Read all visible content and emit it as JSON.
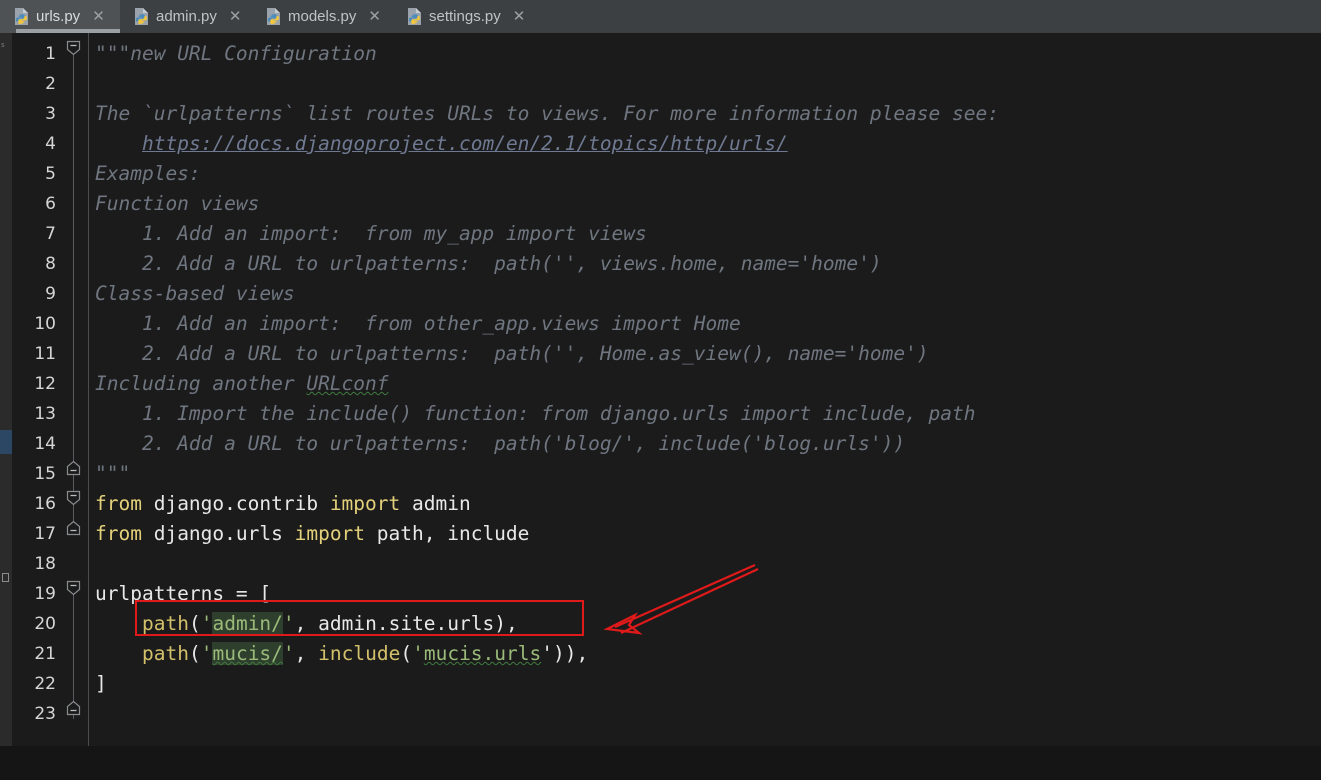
{
  "window": {
    "title": "urls.py"
  },
  "tabs": [
    {
      "label": "urls.py",
      "icon": "python-file-icon",
      "close": "✕",
      "active": true
    },
    {
      "label": "admin.py",
      "icon": "python-file-icon",
      "close": "✕",
      "active": false
    },
    {
      "label": "models.py",
      "icon": "python-file-icon",
      "close": "✕",
      "active": false
    },
    {
      "label": "settings.py",
      "icon": "python-file-icon",
      "close": "✕",
      "active": false
    }
  ],
  "editor": {
    "language": "Python",
    "line_numbers": [
      "1",
      "2",
      "3",
      "4",
      "5",
      "6",
      "7",
      "8",
      "9",
      "10",
      "11",
      "12",
      "13",
      "14",
      "15",
      "16",
      "17",
      "18",
      "19",
      "20",
      "21",
      "22",
      "23"
    ],
    "lines": [
      {
        "n": "1",
        "text": "\"\"\"new URL Configuration"
      },
      {
        "n": "2",
        "text": ""
      },
      {
        "n": "3",
        "text": "The `urlpatterns` list routes URLs to views. For more information please see:"
      },
      {
        "n": "4",
        "text": "    https://docs.djangoproject.com/en/2.1/topics/http/urls/"
      },
      {
        "n": "5",
        "text": "Examples:"
      },
      {
        "n": "6",
        "text": "Function views"
      },
      {
        "n": "7",
        "text": "    1. Add an import:  from my_app import views"
      },
      {
        "n": "8",
        "text": "    2. Add a URL to urlpatterns:  path('', views.home, name='home')"
      },
      {
        "n": "9",
        "text": "Class-based views"
      },
      {
        "n": "10",
        "text": "    1. Add an import:  from other_app.views import Home"
      },
      {
        "n": "11",
        "text": "    2. Add a URL to urlpatterns:  path('', Home.as_view(), name='home')"
      },
      {
        "n": "12",
        "text": "Including another URLconf"
      },
      {
        "n": "13",
        "text": "    1. Import the include() function: from django.urls import include, path"
      },
      {
        "n": "14",
        "text": "    2. Add a URL to urlpatterns:  path('blog/', include('blog.urls'))"
      },
      {
        "n": "15",
        "text": "\"\"\""
      },
      {
        "n": "16",
        "text": "from django.contrib import admin"
      },
      {
        "n": "17",
        "text": "from django.urls import path, include"
      },
      {
        "n": "18",
        "text": ""
      },
      {
        "n": "19",
        "text": "urlpatterns = ["
      },
      {
        "n": "20",
        "text": "    path('admin/', admin.site.urls),"
      },
      {
        "n": "21",
        "text": "    path('mucis/', include('mucis.urls')),"
      },
      {
        "n": "22",
        "text": "]"
      },
      {
        "n": "23",
        "text": ""
      }
    ],
    "tokens": {
      "docstring_open": "\"\"\"",
      "docstring_head": "new URL Configuration",
      "doc_l3_a": "The `urlpatterns` list routes URLs to views. For more information please see:",
      "doc_l4_url": "https://docs.djangoproject.com/en/2.1/topics/http/urls/",
      "doc_l5": "Examples:",
      "doc_l6": "Function views",
      "doc_l7": "    1. Add an import:  from my_app import views",
      "doc_l8": "    2. Add a URL to urlpatterns:  path('', views.home, name='home')",
      "doc_l9": "Class-based views",
      "doc_l10": "    1. Add an import:  from other_app.views import Home",
      "doc_l11": "    2. Add a URL to urlpatterns:  path('', Home.as_view(), name='home')",
      "doc_l12_a": "Including another ",
      "doc_l12_typo": "URLconf",
      "doc_l13": "    1. Import the include() function: from django.urls import include, path",
      "doc_l14": "    2. Add a URL to urlpatterns:  path('blog/', include('blog.urls'))",
      "docstring_close": "\"\"\"",
      "kw_from": "from",
      "kw_import": "import",
      "mod_django_contrib": " django.contrib ",
      "name_admin": " admin",
      "mod_django_urls": " django.urls ",
      "name_path_include": " path, include",
      "urlpatterns": "urlpatterns",
      "eq": " = ",
      "bracket_open": "[",
      "bracket_close": "]",
      "fn_path": "path",
      "paren_open": "(",
      "quote": "'",
      "str_admin_slash": "admin/",
      "arg_admin_site_urls": ", admin.site.urls),",
      "str_mucis_slash": "mucis/",
      "comma_sp": ", ",
      "fn_include": "include",
      "str_mucis_urls": "mucis.urls",
      "tail_mucis": "')),"
    }
  },
  "annotations": {
    "highlight_box": {
      "name": "red-rectangle-highlight",
      "color": "#e01a1a",
      "targets_line": "20"
    },
    "arrow": {
      "name": "red-arrow-pointer",
      "color": "#e01a1a",
      "direction": "down-left"
    },
    "selection_highlight_color": "#2f3f2d",
    "spellcheck_squiggle_color": "#3f7a3f"
  },
  "colors": {
    "tabbar_bg": "#3c4043",
    "active_tab_bg": "#4e5254",
    "editor_bg": "#1b1b1b",
    "gutter_bg": "#1b1b1b",
    "line_number": "#d6d6d6",
    "docstring": "#6f7680",
    "keyword": "#e3d07a",
    "string": "#9aba7a",
    "identifier": "#e8e8e8",
    "link": "#6f7a92"
  }
}
